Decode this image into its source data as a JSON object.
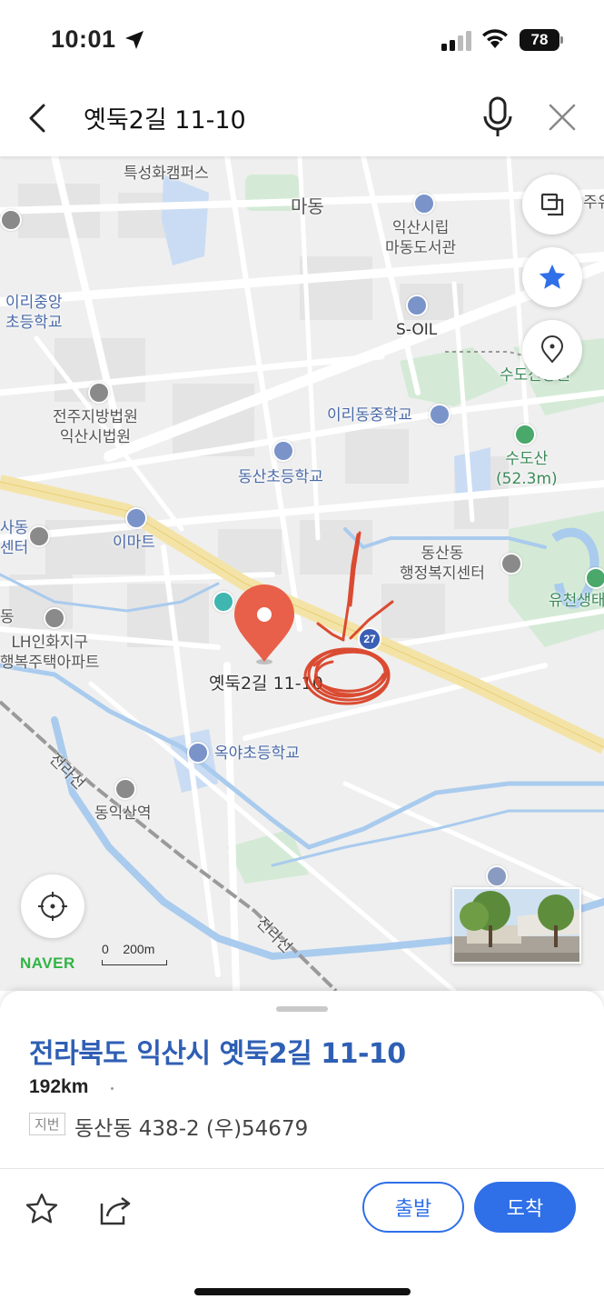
{
  "status_bar": {
    "time": "10:01",
    "battery": "78"
  },
  "search": {
    "query": "옛둑2길 11-10"
  },
  "map": {
    "labels": {
      "campus": "특성화캠퍼스",
      "madong": "마동",
      "library": "익산시립\n마동도서관",
      "soil": "S-OIL",
      "iri_elementary": "이리중앙\n초등학교",
      "court": "전주지방법원\n익산시법원",
      "iridong_middle": "이리동중학교",
      "sudosan": "수도산\n(52.3m)",
      "sudosan_park": "수도산공원",
      "dongsan_elementary": "동산초등학교",
      "emart": "이마트",
      "dongsan_center": "동산동\n행정복지센터",
      "yucheon": "유천생태",
      "sadong_center": "사동\n센터",
      "lh_apartment": "LH인화지구\n행복주택아파트",
      "pin_label": "옛둑2길 11-10",
      "okya_elementary": "옥야초등학교",
      "jeolla_line_1": "전라선",
      "jeolla_line_2": "전라선",
      "dongiksan_station": "동익산역",
      "dong_left": "동",
      "route_badge": "27",
      "juyu": "주유"
    },
    "scale_label": "0    200m",
    "logo": "NAVER",
    "accent_color": "#2f6fe8",
    "pin_color": "#e8604a"
  },
  "controls": {
    "layers_icon": "layers-icon",
    "favorite_icon": "star-icon",
    "location_icon": "location-pin-icon",
    "gps_icon": "crosshair-icon"
  },
  "place": {
    "title": "전라북도 익산시 옛둑2길 11-10",
    "distance": "192km",
    "jibun_tag": "지번",
    "jibun_address": "동산동 438-2 (우)54679"
  },
  "actions": {
    "depart": "출발",
    "arrive": "도착"
  }
}
